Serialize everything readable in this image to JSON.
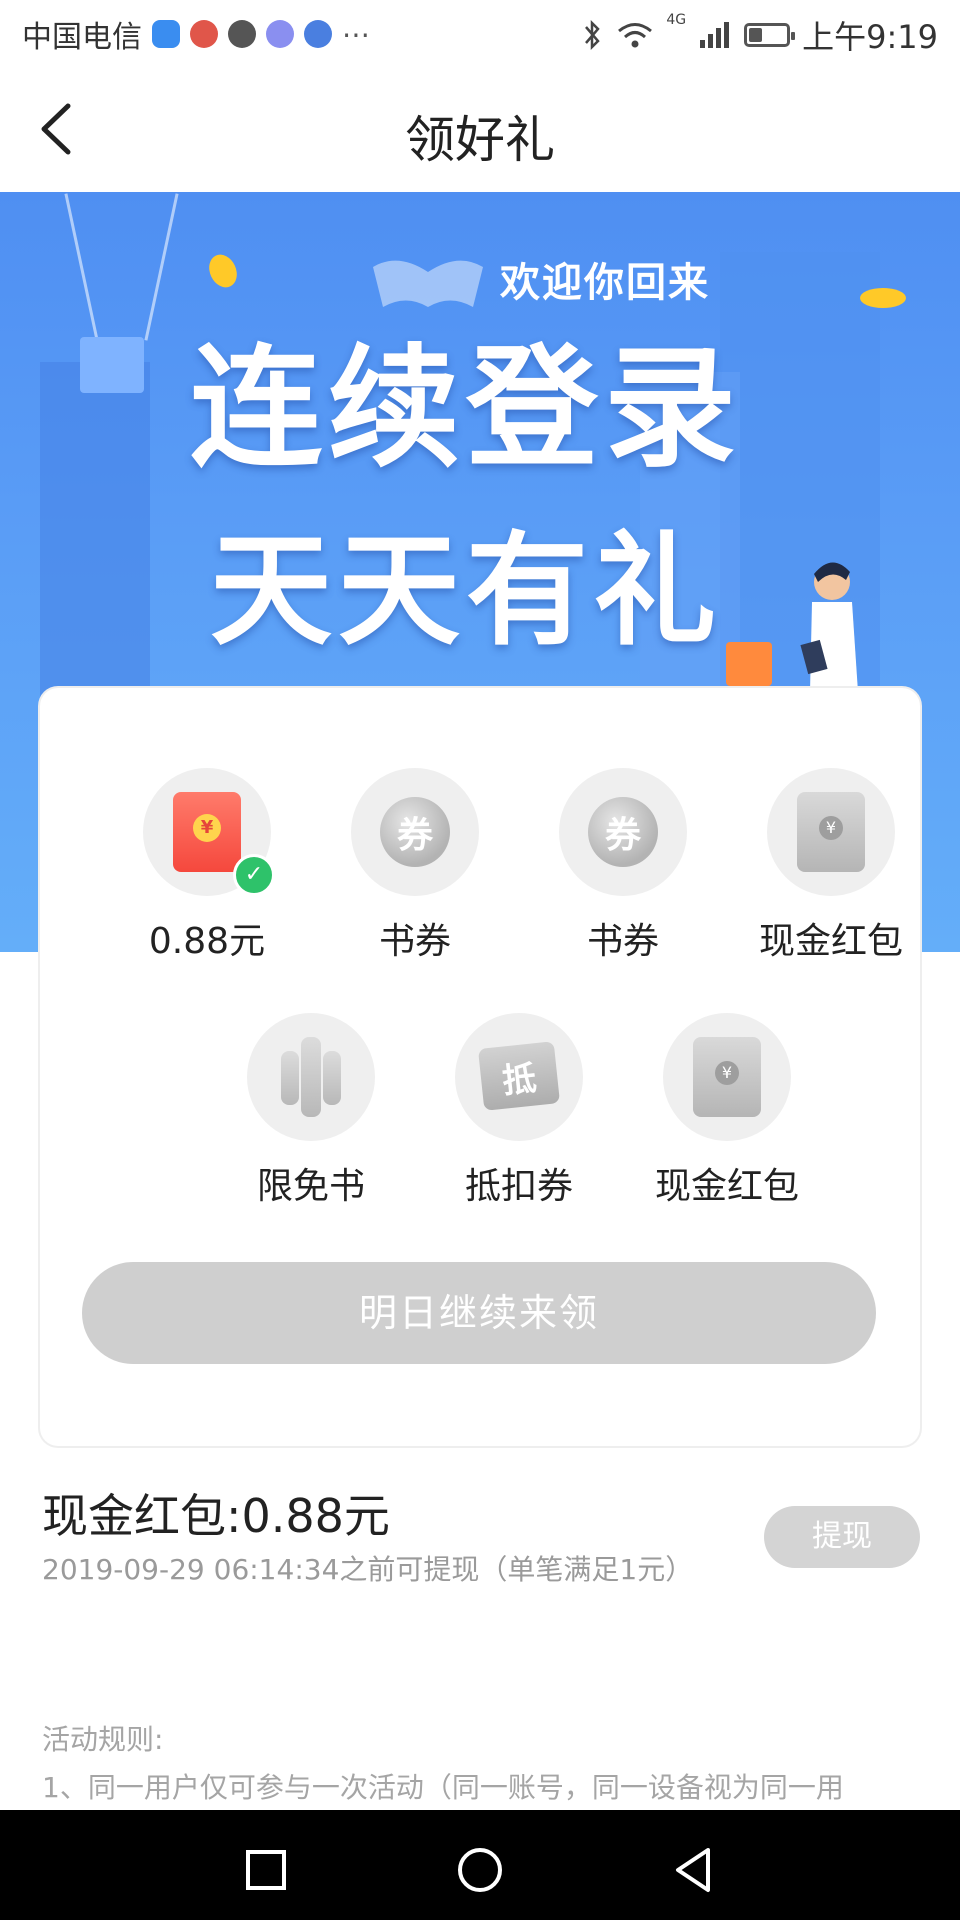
{
  "status_bar": {
    "carrier": "中国电信",
    "network": "4G",
    "time": "上午9:19",
    "battery_percent": 35
  },
  "header": {
    "title": "领好礼"
  },
  "banner": {
    "welcome_text": "欢迎你回来",
    "headline_line1": "连续登录",
    "headline_line2": "天天有礼"
  },
  "rewards": {
    "items": [
      {
        "label": "0.88元",
        "icon": "red-envelope-icon",
        "claimed": true
      },
      {
        "label": "书券",
        "icon": "coupon-icon",
        "icon_char": "券",
        "claimed": false
      },
      {
        "label": "书券",
        "icon": "coupon-icon",
        "icon_char": "券",
        "claimed": false
      },
      {
        "label": "现金红包",
        "icon": "cash-envelope-icon",
        "icon_char": "¥",
        "claimed": false
      },
      {
        "label": "限免书",
        "icon": "books-icon",
        "claimed": false
      },
      {
        "label": "抵扣券",
        "icon": "deduction-ticket-icon",
        "icon_char": "抵",
        "claimed": false
      },
      {
        "label": "现金红包",
        "icon": "cash-envelope-icon",
        "icon_char": "¥",
        "claimed": false
      }
    ],
    "action_button": "明日继续来领"
  },
  "cash": {
    "title": "现金红包:0.88元",
    "subtitle": "2019-09-29 06:14:34之前可提现（单笔满足1元）",
    "withdraw_button": "提现"
  },
  "rules": {
    "title": "活动规则:",
    "line1": "1、同一用户仅可参与一次活动（同一账号，同一设备视为同一用"
  },
  "colors": {
    "banner_blue": "#5a9df6",
    "claimed_green": "#2ec26a",
    "disabled_gray": "#cfcfcf",
    "red_envelope": "#f5483d"
  }
}
